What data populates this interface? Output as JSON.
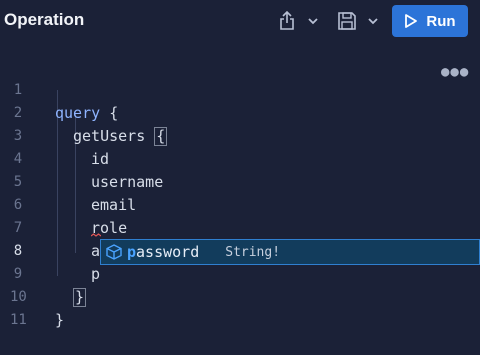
{
  "header": {
    "title": "Operation",
    "run_label": "Run"
  },
  "editor": {
    "lines": [
      {
        "num": "1",
        "text": "query"
      },
      {
        "num": "2",
        "text": "getUsers"
      },
      {
        "num": "3",
        "text": "id"
      },
      {
        "num": "4",
        "text": "username"
      },
      {
        "num": "5",
        "text": "email"
      },
      {
        "num": "6",
        "text": "role"
      },
      {
        "num": "7",
        "text": "active"
      },
      {
        "num": "8",
        "text": "p"
      },
      {
        "num": "9",
        "text": "}"
      },
      {
        "num": "10",
        "text": "}"
      },
      {
        "num": "11",
        "text": ""
      }
    ],
    "open_brace": "{",
    "active_line": "8"
  },
  "autocomplete": {
    "match": "p",
    "rest": "assword",
    "type": "String!"
  },
  "icons": {
    "share": "share-icon",
    "save": "save-icon",
    "run": "play-icon",
    "more": "more-horizontal-icon",
    "field": "field-cube-icon"
  },
  "colors": {
    "background": "#1b2137",
    "run_button": "#2c74d8",
    "suggest_bg": "#123c5c",
    "match_highlight": "#4aa3ff"
  }
}
